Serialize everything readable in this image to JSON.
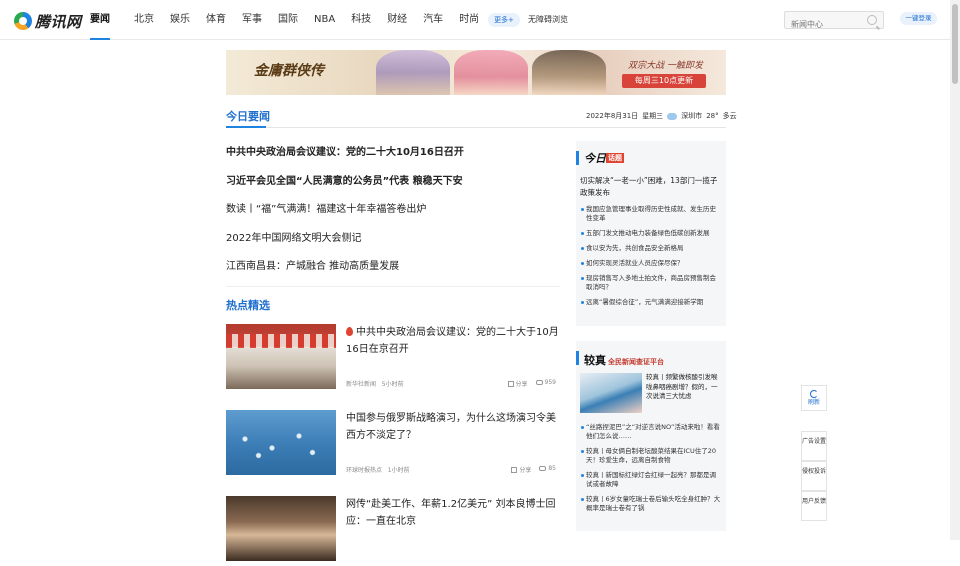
{
  "nav": {
    "logo": "腾讯网",
    "items": [
      "要闻",
      "北京",
      "娱乐",
      "体育",
      "军事",
      "国际",
      "NBA",
      "科技",
      "财经",
      "汽车",
      "时尚",
      "游戏"
    ],
    "more": "更多+",
    "barrier_free": "无障碍浏览",
    "search_placeholder": "新闻中心",
    "login": "一键登录"
  },
  "banner": {
    "logo": "金庸群侠传",
    "slogan": "双宗大战 一触即发",
    "cta": "每周三10点更新"
  },
  "today": {
    "tab": "今日要闻",
    "date": "2022年8月31日",
    "weekday": "星期三",
    "city": "深圳市",
    "temp": "28°",
    "weather": "多云",
    "headlines": [
      "中共中央政治局会议建议：党的二十大10月16日召开",
      "习近平会见全国“人民满意的公务员”代表 粮稳天下安",
      "数读丨“福”气满满！福建这十年幸福答卷出炉",
      "2022年中国网络文明大会侧记",
      "江西南昌县：产城融合 推动高质量发展"
    ]
  },
  "hot": {
    "title": "热点精选",
    "items": [
      {
        "title": "中共中央政治局会议建议：党的二十大于10月16日在京召开",
        "source": "新华社新闻",
        "time": "5小时前",
        "share": "分享",
        "comments": "959"
      },
      {
        "title": "中国参与俄罗斯战略演习，为什么这场演习令美西方不淡定了？",
        "source": "环球时报热点",
        "time": "1小时前",
        "share": "分享",
        "comments": "85"
      },
      {
        "title": "网传“赴美工作、年薪1.2亿美元” 刘本良博士回应：一直在北京"
      }
    ]
  },
  "panel1": {
    "logo": "今日",
    "logo_tag": "话题",
    "lead": "切实解决“一老一小”困难，13部门一揽子政策发布",
    "items": [
      "我国应急管理事业取得历史性成就、发生历史性变革",
      "五部门发文推动电力装备绿色低碳创新发展",
      "食以安为先，共创食品安全新格局",
      "如何实现灵活就业人员应保尽保？",
      "现房销售写入多地土拍文件，商品房预售制会取消吗？",
      "远离“暑假综合征”，元气满满迎接新学期"
    ]
  },
  "panel2": {
    "logo": "较真",
    "logo_sub": "全民新闻查证平台",
    "lead": "较真丨频繁做核酸引发喉咙鼻咽癌剧增？假的，一次说清三大忧虑",
    "items": [
      "“丝路捏泥巴”之“对逆言说NO”活动来啦！看看他们怎么说……",
      "较真丨母女俩自制老坛酸菜结果在ICU住了20天！珍爱生命，远离自制食物",
      "较真丨新国标红绿灯会红绿一起亮？那都是调试或者故障",
      "较真丨6岁女童吃瑞士卷后输头吃全身红肿？大概率是瑞士卷有了锅"
    ]
  },
  "tools": {
    "refresh": "刷新",
    "ad": "广告设置",
    "report": "侵权投诉",
    "feedback": "用户反馈"
  }
}
